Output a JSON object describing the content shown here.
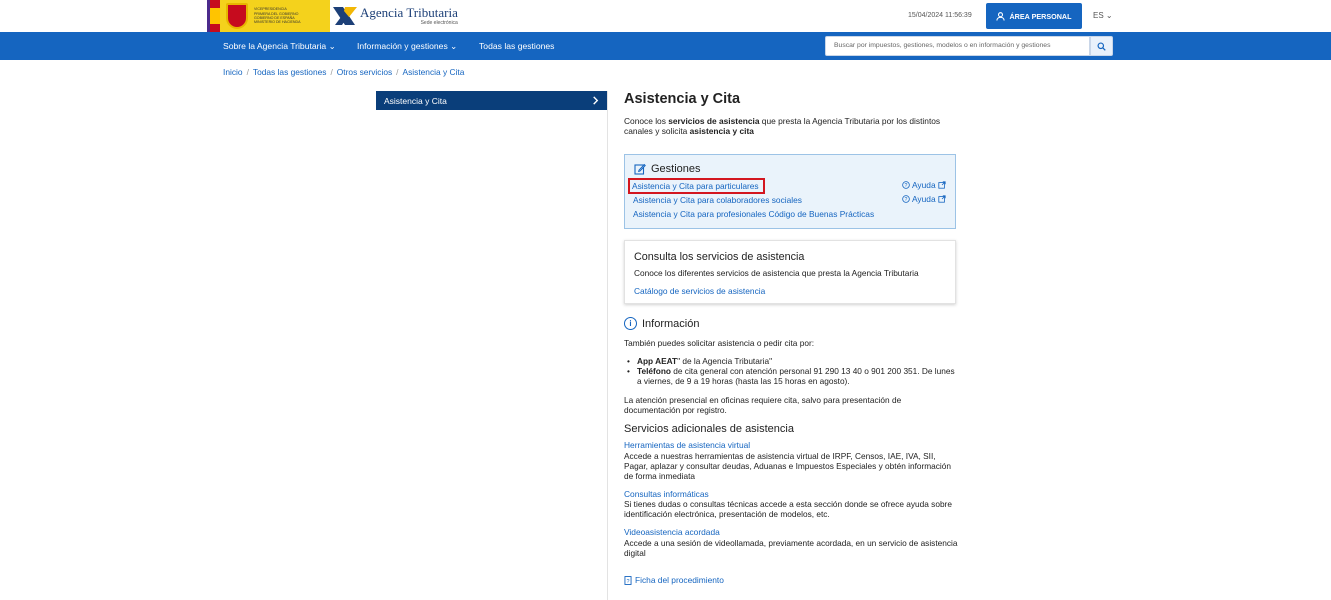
{
  "header": {
    "gov_text": [
      "Vicepresidencia",
      "Primera del Gobierno",
      "Gobierno de España",
      "Ministerio de Hacienda"
    ],
    "agency_name": "Agencia Tributaria",
    "agency_sub": "Sede electrónica",
    "timestamp": "15/04/2024 11:56:39",
    "area_personal": "ÁREA PERSONAL",
    "language": "ES"
  },
  "nav": {
    "items": [
      "Sobre la Agencia Tributaria",
      "Información y gestiones",
      "Todas las gestiones"
    ],
    "search_placeholder": "Buscar por impuestos, gestiones, modelos o en información y gestiones"
  },
  "breadcrumb": [
    "Inicio",
    "Todas las gestiones",
    "Otros servicios",
    "Asistencia y Cita"
  ],
  "side_menu": {
    "active": "Asistencia y Cita"
  },
  "main": {
    "title": "Asistencia y Cita",
    "intro_1": "Conoce los ",
    "intro_bold_1": "servicios de asistencia",
    "intro_2": " que presta la Agencia Tributaria por los distintos canales y solicita ",
    "intro_bold_2": "asistencia y cita",
    "gestiones": {
      "title": "Gestiones",
      "links": [
        "Asistencia y Cita para particulares",
        "Asistencia y Cita para colaboradores sociales",
        "Asistencia y Cita para profesionales Código de Buenas Prácticas"
      ],
      "help_label": "Ayuda"
    },
    "consulta": {
      "title": "Consulta los servicios de asistencia",
      "desc": "Conoce los diferentes servicios de asistencia que presta la Agencia Tributaria",
      "link": "Catálogo de servicios de asistencia"
    },
    "informacion": {
      "title": "Información",
      "p1": "También puedes solicitar asistencia o pedir cita por:",
      "b1_bold": "App AEAT",
      "b1_rest": "\" de la Agencia Tributaria\"",
      "b2_bold": "Teléfono",
      "b2_rest": " de cita general con atención personal 91 290 13 40 o 901 200 351. De lunes a viernes, de 9 a 19 horas (hasta las 15 horas en agosto).",
      "p2": "La atención presencial en oficinas requiere cita, salvo para presentación de documentación por registro."
    },
    "servicios": {
      "title": "Servicios adicionales de asistencia",
      "items": [
        {
          "link": "Herramientas de asistencia virtual",
          "desc": "Accede a nuestras herramientas de asistencia virtual de IRPF, Censos, IAE, IVA, SII, Pagar, aplazar y consultar deudas, Aduanas e Impuestos Especiales y obtén información de forma inmediata"
        },
        {
          "link": "Consultas informáticas",
          "desc": "Si tienes dudas o consultas técnicas accede a esta sección donde se ofrece ayuda sobre identificación electrónica, presentación de modelos, etc."
        },
        {
          "link": "Videoasistencia acordada",
          "desc": "Accede a una sesión de videollamada, previamente acordada, en un servicio de asistencia digital"
        }
      ]
    },
    "ficha": "Ficha del procedimiento"
  },
  "colors": {
    "primary": "#1565c0",
    "dark_blue": "#0a3e7a",
    "highlight": "#d3161f",
    "box_bg": "#eaf3fb"
  }
}
